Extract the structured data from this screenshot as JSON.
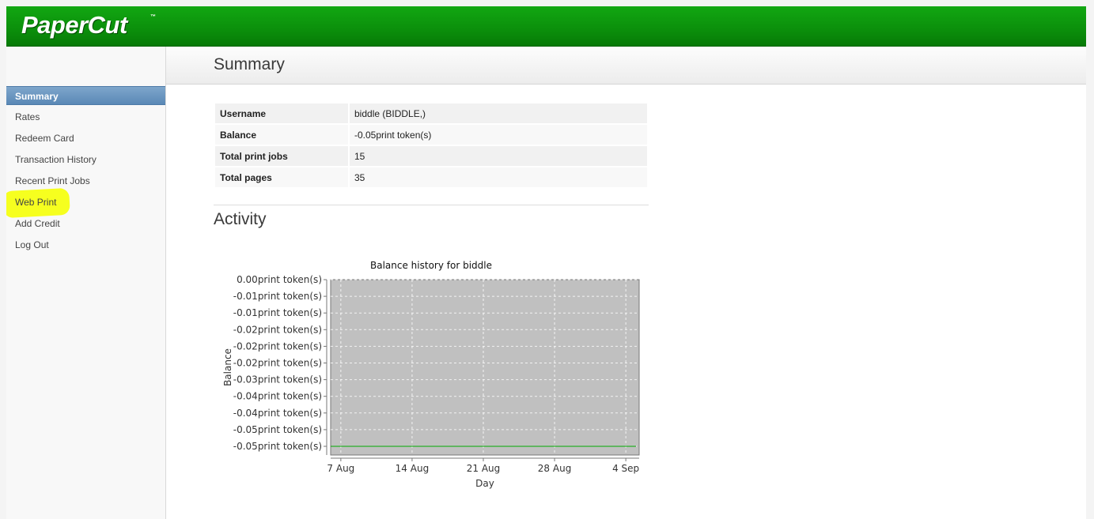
{
  "app": {
    "logo": "PaperCut",
    "logo_tm": "™"
  },
  "sidebar": {
    "items": [
      {
        "label": "Summary",
        "active": true
      },
      {
        "label": "Rates"
      },
      {
        "label": "Redeem Card"
      },
      {
        "label": "Transaction History"
      },
      {
        "label": "Recent Print Jobs"
      },
      {
        "label": "Web Print",
        "highlighted": true
      },
      {
        "label": "Add Credit"
      },
      {
        "label": "Log Out"
      }
    ]
  },
  "main": {
    "title": "Summary",
    "summary": [
      {
        "key": "Username",
        "value": "biddle (BIDDLE,)"
      },
      {
        "key": "Balance",
        "value": "-0.05print token(s)"
      },
      {
        "key": "Total print jobs",
        "value": "15"
      },
      {
        "key": "Total pages",
        "value": "35"
      }
    ],
    "activity_title": "Activity"
  },
  "colors": {
    "header_green": "#0b8f0b",
    "active_nav": "#5a88b6",
    "highlight": "#f6ff1f",
    "plot_bg": "#c0c0c0",
    "series": "#00aa00"
  },
  "chart_data": {
    "type": "line",
    "title": "Balance history for biddle",
    "xlabel": "Day",
    "ylabel": "Balance",
    "x_ticks": [
      "7 Aug",
      "14 Aug",
      "21 Aug",
      "28 Aug",
      "4 Sep"
    ],
    "y_ticks": [
      "0.00print token(s)",
      "-0.01print token(s)",
      "-0.01print token(s)",
      "-0.02print token(s)",
      "-0.02print token(s)",
      "-0.02print token(s)",
      "-0.03print token(s)",
      "-0.04print token(s)",
      "-0.04print token(s)",
      "-0.05print token(s)",
      "-0.05print token(s)"
    ],
    "series": [
      {
        "x": [
          "6 Aug",
          "5 Sep"
        ],
        "y": [
          -0.05,
          -0.05
        ]
      }
    ],
    "grid": true
  }
}
